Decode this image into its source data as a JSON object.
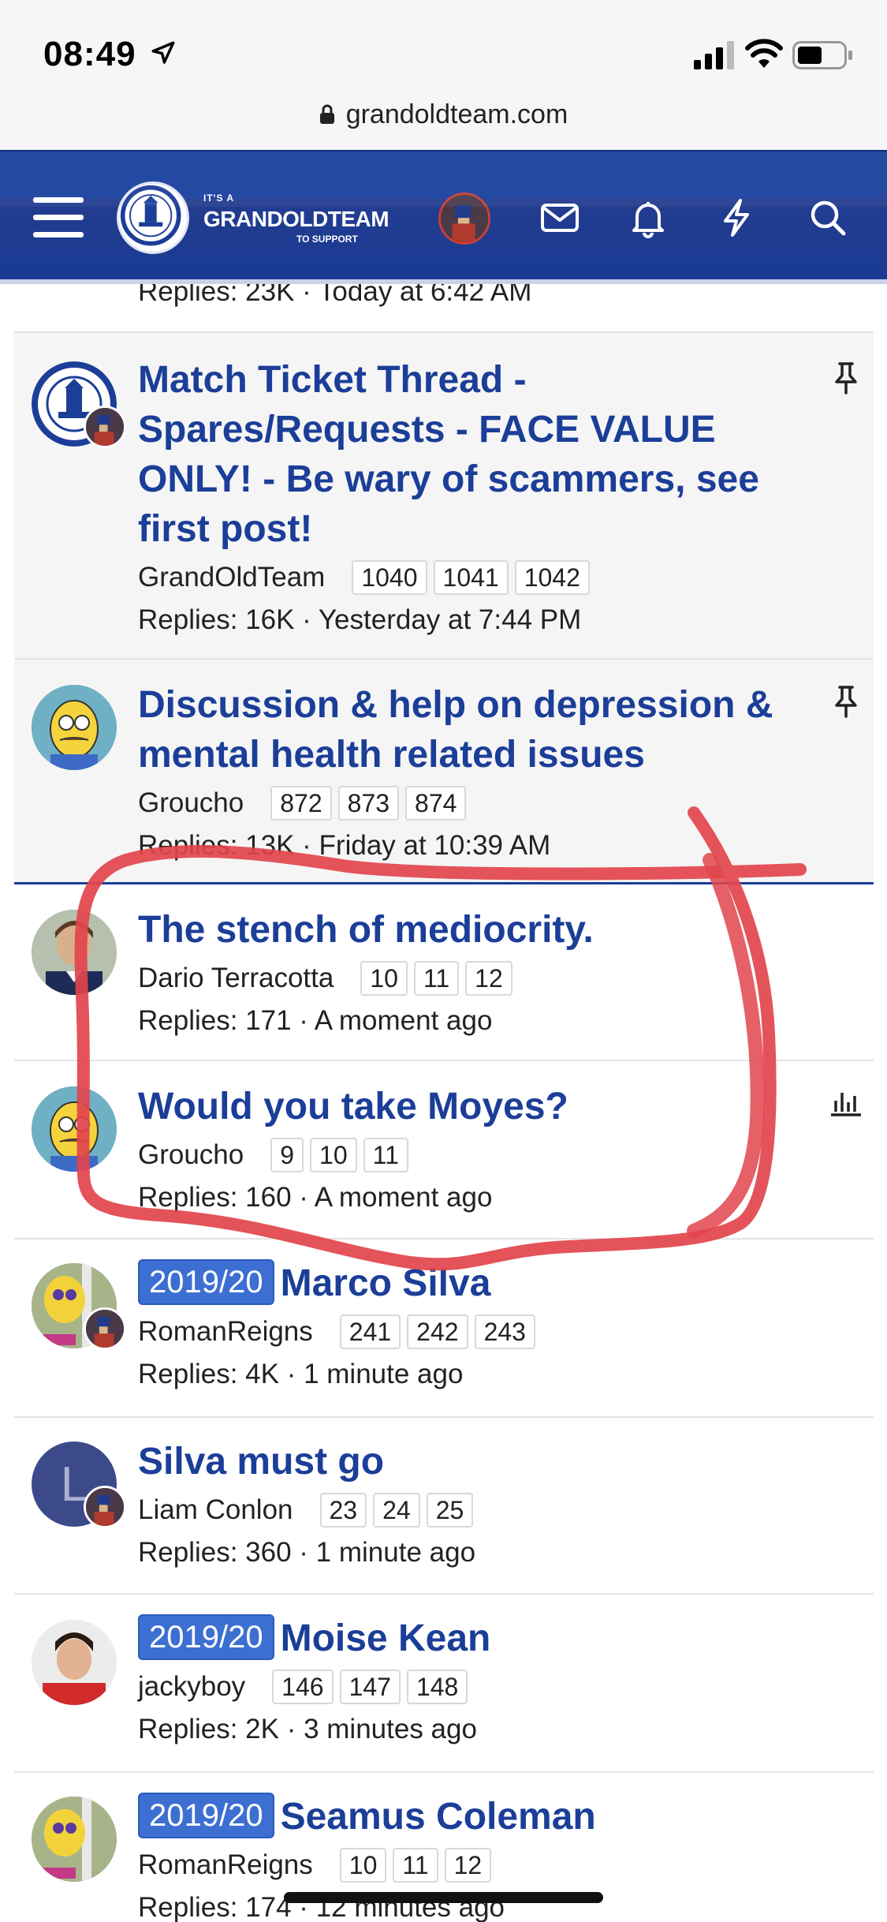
{
  "status_bar": {
    "time": "08:49"
  },
  "url_bar": {
    "domain": "grandoldteam.com"
  },
  "header": {
    "logo": {
      "small": "IT'S A",
      "main": "GRANDOLDTEAM",
      "sub": "TO SUPPORT"
    },
    "icons": [
      "menu-icon",
      "avatar",
      "mail-icon",
      "bell-icon",
      "bolt-icon",
      "search-icon"
    ]
  },
  "threads": [
    {
      "meta": "Replies: 23K · Today at 6:42 AM",
      "partial": true
    },
    {
      "title": "Match Ticket Thread - Spares/Requests - FACE VALUE ONLY! - Be wary of scammers, see first post!",
      "author": "GrandOldTeam",
      "pages": [
        "1040",
        "1041",
        "1042"
      ],
      "meta": "Replies: 16K · Yesterday at 7:44 PM",
      "sticky": true,
      "icon": "pin-icon"
    },
    {
      "title": "Discussion & help on depression & mental health related issues",
      "author": "Groucho",
      "pages": [
        "872",
        "873",
        "874"
      ],
      "meta": "Replies: 13K · Friday at 10:39 AM",
      "sticky": true,
      "icon": "pin-icon"
    },
    {
      "title": "The stench of mediocrity.",
      "author": "Dario Terracotta",
      "pages": [
        "10",
        "11",
        "12"
      ],
      "meta": "Replies: 171 · A moment ago"
    },
    {
      "title": "Would you take Moyes?",
      "author": "Groucho",
      "pages": [
        "9",
        "10",
        "11"
      ],
      "meta": "Replies: 160 · A moment ago",
      "icon": "poll-icon"
    },
    {
      "prefix": "2019/20",
      "title": "Marco Silva",
      "author": "RomanReigns",
      "pages": [
        "241",
        "242",
        "243"
      ],
      "meta": "Replies: 4K · 1 minute ago"
    },
    {
      "title": "Silva must go",
      "author": "Liam Conlon",
      "avatar_letter": "L",
      "pages": [
        "23",
        "24",
        "25"
      ],
      "meta": "Replies: 360 · 1 minute ago"
    },
    {
      "prefix": "2019/20",
      "title": "Moise Kean",
      "author": "jackyboy",
      "pages": [
        "146",
        "147",
        "148"
      ],
      "meta": "Replies: 2K · 3 minutes ago"
    },
    {
      "prefix": "2019/20",
      "title": "Seamus Coleman",
      "author": "RomanReigns",
      "pages": [
        "10",
        "11",
        "12"
      ],
      "meta": "Replies: 174 · 12 minutes ago"
    }
  ],
  "colors": {
    "header_blue": "#19409e",
    "title_blue": "#1b3e98",
    "prefix_blue": "#3d6fd2",
    "annotation_red": "#e2444c"
  }
}
